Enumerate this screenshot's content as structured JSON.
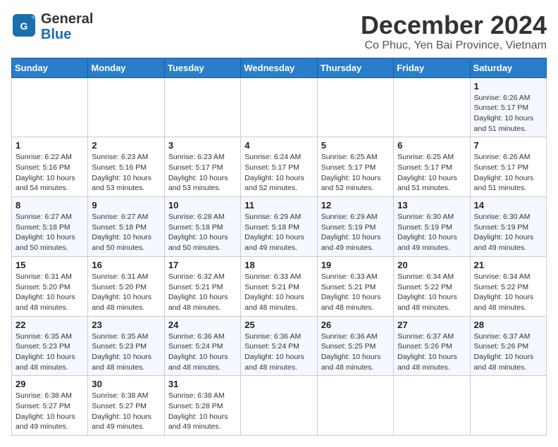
{
  "header": {
    "logo_line1": "General",
    "logo_line2": "Blue",
    "title": "December 2024",
    "subtitle": "Co Phuc, Yen Bai Province, Vietnam"
  },
  "calendar": {
    "days_of_week": [
      "Sunday",
      "Monday",
      "Tuesday",
      "Wednesday",
      "Thursday",
      "Friday",
      "Saturday"
    ],
    "weeks": [
      [
        null,
        null,
        null,
        null,
        null,
        null,
        {
          "day": 1,
          "sunrise": "6:26 AM",
          "sunset": "5:17 PM",
          "daylight": "10 hours and 51 minutes."
        }
      ],
      [
        {
          "day": 1,
          "sunrise": "6:22 AM",
          "sunset": "5:16 PM",
          "daylight": "10 hours and 54 minutes."
        },
        {
          "day": 2,
          "sunrise": "6:23 AM",
          "sunset": "5:16 PM",
          "daylight": "10 hours and 53 minutes."
        },
        {
          "day": 3,
          "sunrise": "6:23 AM",
          "sunset": "5:17 PM",
          "daylight": "10 hours and 53 minutes."
        },
        {
          "day": 4,
          "sunrise": "6:24 AM",
          "sunset": "5:17 PM",
          "daylight": "10 hours and 52 minutes."
        },
        {
          "day": 5,
          "sunrise": "6:25 AM",
          "sunset": "5:17 PM",
          "daylight": "10 hours and 52 minutes."
        },
        {
          "day": 6,
          "sunrise": "6:25 AM",
          "sunset": "5:17 PM",
          "daylight": "10 hours and 51 minutes."
        },
        {
          "day": 7,
          "sunrise": "6:26 AM",
          "sunset": "5:17 PM",
          "daylight": "10 hours and 51 minutes."
        }
      ],
      [
        {
          "day": 8,
          "sunrise": "6:27 AM",
          "sunset": "5:18 PM",
          "daylight": "10 hours and 50 minutes."
        },
        {
          "day": 9,
          "sunrise": "6:27 AM",
          "sunset": "5:18 PM",
          "daylight": "10 hours and 50 minutes."
        },
        {
          "day": 10,
          "sunrise": "6:28 AM",
          "sunset": "5:18 PM",
          "daylight": "10 hours and 50 minutes."
        },
        {
          "day": 11,
          "sunrise": "6:29 AM",
          "sunset": "5:18 PM",
          "daylight": "10 hours and 49 minutes."
        },
        {
          "day": 12,
          "sunrise": "6:29 AM",
          "sunset": "5:19 PM",
          "daylight": "10 hours and 49 minutes."
        },
        {
          "day": 13,
          "sunrise": "6:30 AM",
          "sunset": "5:19 PM",
          "daylight": "10 hours and 49 minutes."
        },
        {
          "day": 14,
          "sunrise": "6:30 AM",
          "sunset": "5:19 PM",
          "daylight": "10 hours and 49 minutes."
        }
      ],
      [
        {
          "day": 15,
          "sunrise": "6:31 AM",
          "sunset": "5:20 PM",
          "daylight": "10 hours and 48 minutes."
        },
        {
          "day": 16,
          "sunrise": "6:31 AM",
          "sunset": "5:20 PM",
          "daylight": "10 hours and 48 minutes."
        },
        {
          "day": 17,
          "sunrise": "6:32 AM",
          "sunset": "5:21 PM",
          "daylight": "10 hours and 48 minutes."
        },
        {
          "day": 18,
          "sunrise": "6:33 AM",
          "sunset": "5:21 PM",
          "daylight": "10 hours and 48 minutes."
        },
        {
          "day": 19,
          "sunrise": "6:33 AM",
          "sunset": "5:21 PM",
          "daylight": "10 hours and 48 minutes."
        },
        {
          "day": 20,
          "sunrise": "6:34 AM",
          "sunset": "5:22 PM",
          "daylight": "10 hours and 48 minutes."
        },
        {
          "day": 21,
          "sunrise": "6:34 AM",
          "sunset": "5:22 PM",
          "daylight": "10 hours and 48 minutes."
        }
      ],
      [
        {
          "day": 22,
          "sunrise": "6:35 AM",
          "sunset": "5:23 PM",
          "daylight": "10 hours and 48 minutes."
        },
        {
          "day": 23,
          "sunrise": "6:35 AM",
          "sunset": "5:23 PM",
          "daylight": "10 hours and 48 minutes."
        },
        {
          "day": 24,
          "sunrise": "6:36 AM",
          "sunset": "5:24 PM",
          "daylight": "10 hours and 48 minutes."
        },
        {
          "day": 25,
          "sunrise": "6:36 AM",
          "sunset": "5:24 PM",
          "daylight": "10 hours and 48 minutes."
        },
        {
          "day": 26,
          "sunrise": "6:36 AM",
          "sunset": "5:25 PM",
          "daylight": "10 hours and 48 minutes."
        },
        {
          "day": 27,
          "sunrise": "6:37 AM",
          "sunset": "5:26 PM",
          "daylight": "10 hours and 48 minutes."
        },
        {
          "day": 28,
          "sunrise": "6:37 AM",
          "sunset": "5:26 PM",
          "daylight": "10 hours and 48 minutes."
        }
      ],
      [
        {
          "day": 29,
          "sunrise": "6:38 AM",
          "sunset": "5:27 PM",
          "daylight": "10 hours and 49 minutes."
        },
        {
          "day": 30,
          "sunrise": "6:38 AM",
          "sunset": "5:27 PM",
          "daylight": "10 hours and 49 minutes."
        },
        {
          "day": 31,
          "sunrise": "6:38 AM",
          "sunset": "5:28 PM",
          "daylight": "10 hours and 49 minutes."
        },
        null,
        null,
        null,
        null
      ]
    ]
  }
}
